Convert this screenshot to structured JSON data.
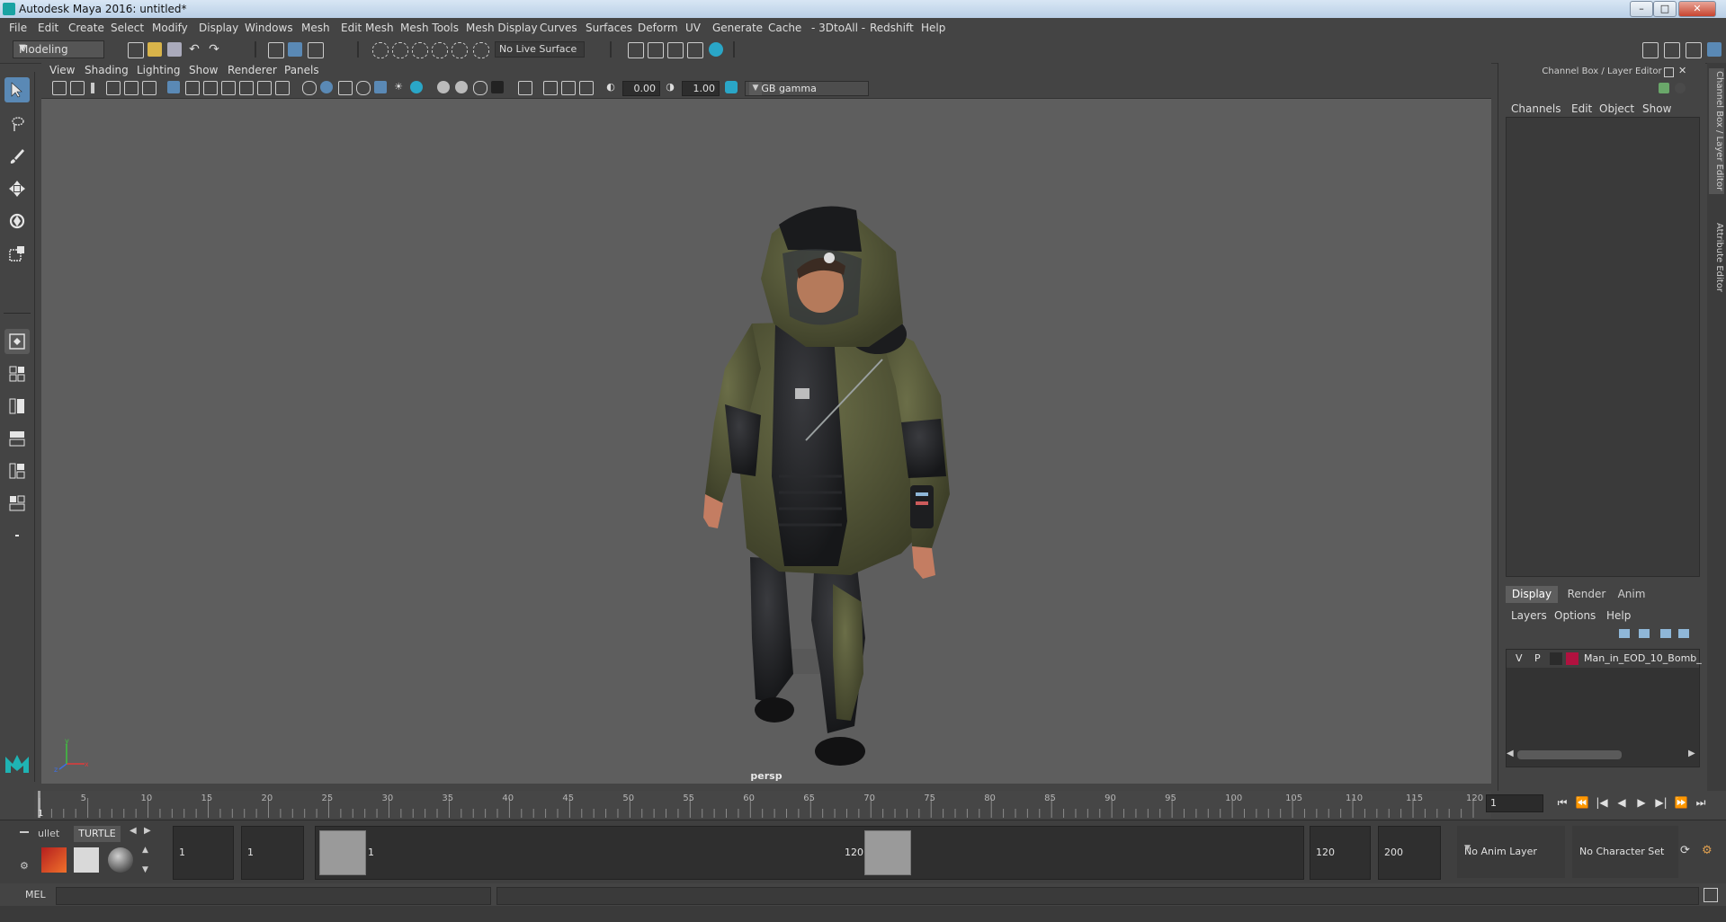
{
  "window": {
    "title": "Autodesk Maya 2016: untitled*",
    "minimize": "–",
    "maximize": "□",
    "close": "✕"
  },
  "menubar": [
    "File",
    "Edit",
    "Create",
    "Select",
    "Modify",
    "Display",
    "Windows",
    "Mesh",
    "Edit Mesh",
    "Mesh Tools",
    "Mesh Display",
    "Curves",
    "Surfaces",
    "Deform",
    "UV",
    "Generate",
    "Cache",
    "- 3DtoAll -",
    "Redshift",
    "Help"
  ],
  "statusline": {
    "mode": "Modeling",
    "live_surface": "No Live Surface"
  },
  "viewport": {
    "menus": [
      "View",
      "Shading",
      "Lighting",
      "Show",
      "Renderer",
      "Panels"
    ],
    "exposure": "0.00",
    "gamma": "1.00",
    "color_space": "sRGB gamma",
    "camera_label": "persp"
  },
  "right_panel": {
    "title": "Channel Box / Layer Editor",
    "channel_menus": [
      "Channels",
      "Edit",
      "Object",
      "Show"
    ],
    "tabs": [
      "Display",
      "Render",
      "Anim"
    ],
    "layer_menus": [
      "Layers",
      "Options",
      "Help"
    ],
    "layer": {
      "visible": "V",
      "playback": "P",
      "name": "Man_in_EOD_10_Bomb_",
      "color": "#b1113f"
    },
    "side_tabs": [
      "Channel Box / Layer Editor",
      "Attribute Editor"
    ]
  },
  "timeline": {
    "ticks": [
      1,
      5,
      10,
      15,
      20,
      25,
      30,
      35,
      40,
      45,
      50,
      55,
      60,
      65,
      70,
      75,
      80,
      85,
      90,
      95,
      100,
      105,
      110,
      115,
      120
    ],
    "current_frame": "1",
    "playback_buttons": [
      "⏮",
      "⏪",
      "|◀",
      "◀",
      "▶",
      "▶|",
      "⏩",
      "⏭"
    ]
  },
  "range": {
    "shelf_tabs": [
      "ullet",
      "TURTLE"
    ],
    "start": "1",
    "playback_start": "1",
    "range_start_label": "1",
    "range_end_label": "120",
    "playback_end": "120",
    "end": "200",
    "anim_layer": "No Anim Layer",
    "character_set": "No Character Set"
  },
  "command_line": {
    "label": "MEL"
  }
}
